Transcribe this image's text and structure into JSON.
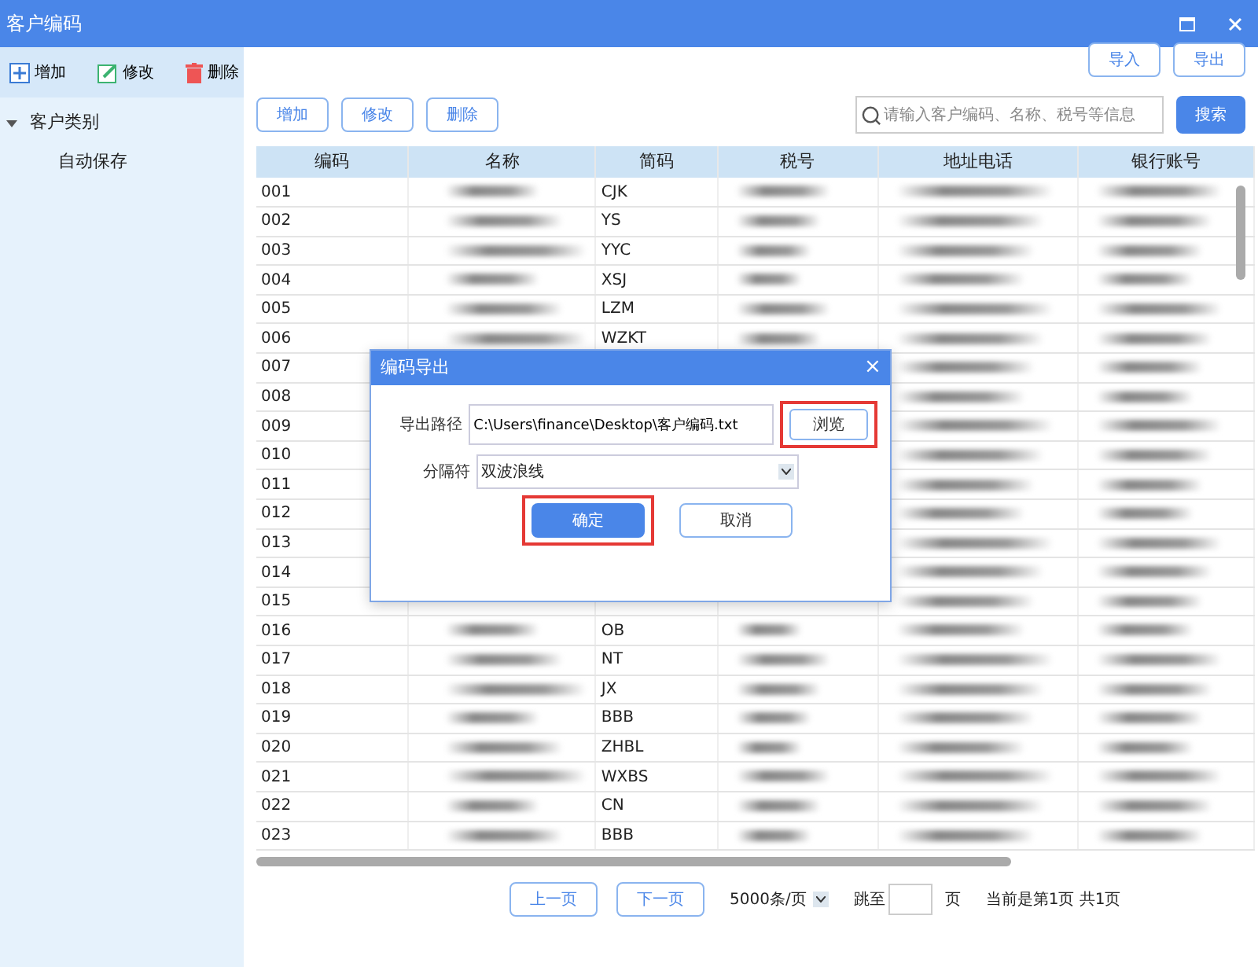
{
  "window": {
    "title": "客户编码"
  },
  "sidebar": {
    "toolbar": [
      {
        "label": "增加",
        "kind": "add"
      },
      {
        "label": "修改",
        "kind": "edit"
      },
      {
        "label": "删除",
        "kind": "delete"
      }
    ],
    "tree": [
      {
        "label": "客户类别",
        "expanded": true,
        "children": [
          {
            "label": "自动保存"
          }
        ]
      }
    ]
  },
  "top_buttons": [
    "导入",
    "导出"
  ],
  "actions": [
    "增加",
    "修改",
    "删除"
  ],
  "search": {
    "placeholder": "请输入客户编码、名称、税号等信息",
    "button": "搜索"
  },
  "table": {
    "columns": [
      "编码",
      "名称",
      "简码",
      "税号",
      "地址电话",
      "银行账号"
    ],
    "rows": [
      {
        "code": "001",
        "abbr": "CJK"
      },
      {
        "code": "002",
        "abbr": "YS"
      },
      {
        "code": "003",
        "abbr": "YYC"
      },
      {
        "code": "004",
        "abbr": "XSJ"
      },
      {
        "code": "005",
        "abbr": "LZM"
      },
      {
        "code": "006",
        "abbr": "WZKT"
      },
      {
        "code": "007"
      },
      {
        "code": "008"
      },
      {
        "code": "009"
      },
      {
        "code": "010"
      },
      {
        "code": "011"
      },
      {
        "code": "012"
      },
      {
        "code": "013"
      },
      {
        "code": "014"
      },
      {
        "code": "015"
      },
      {
        "code": "016",
        "abbr": "OB"
      },
      {
        "code": "017",
        "abbr": "NT"
      },
      {
        "code": "018",
        "abbr": "JX"
      },
      {
        "code": "019",
        "abbr": "BBB"
      },
      {
        "code": "020",
        "abbr": "ZHBL"
      },
      {
        "code": "021",
        "abbr": "WXBS"
      },
      {
        "code": "022",
        "abbr": "CN"
      },
      {
        "code": "023",
        "abbr": "BBB"
      }
    ]
  },
  "pagination": {
    "prev": "上一页",
    "next": "下一页",
    "page_size": "5000条/页",
    "jump_label": "跳至",
    "page_unit": "页",
    "status": "当前是第1页 共1页"
  },
  "dialog": {
    "title": "编码导出",
    "close": "×",
    "fields": [
      {
        "label": "导出路径",
        "value": "C:\\Users\\finance\\Desktop\\客户编码.txt",
        "kind": "text",
        "button": {
          "label": "浏览",
          "highlighted": true
        }
      },
      {
        "label": "分隔符",
        "value": "双波浪线",
        "kind": "select"
      }
    ],
    "buttons": [
      {
        "label": "确定",
        "primary": true,
        "highlighted": true
      },
      {
        "label": "取消",
        "primary": false,
        "highlighted": false
      }
    ]
  }
}
